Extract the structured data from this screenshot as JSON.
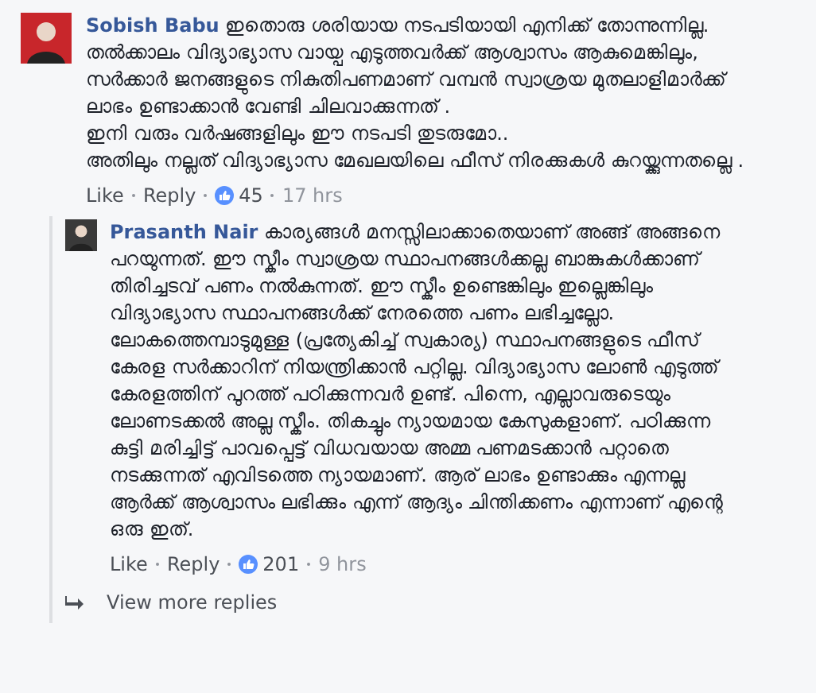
{
  "comments": [
    {
      "author": "Sobish Babu",
      "paragraphs": [
        "ഇതൊരു ശരിയായ നടപടിയായി എനിക്ക് തോന്നുന്നില്ല. തൽക്കാലം വിദ്യാഭ്യാസ വായ്പ എടുത്തവർക്ക് ആശ്വാസം ആകുമെങ്കിലും, സർക്കാർ ജനങ്ങളുടെ നികുതിപണമാണ് വമ്പൻ സ്വാശ്രയ മുതലാളിമാർക്ക് ലാഭം ഉണ്ടാക്കാൻ വേണ്ടി ചിലവാക്കുന്നത് .",
        "ഇനി വരും വർഷങ്ങളിലും ഈ നടപടി തുടരുമോ..",
        "അതിലും നല്ലത് വിദ്യാഭ്യാസ മേഖലയിലെ ഫീസ് നിരക്കുകൾ കുറയ്ക്കുന്നതല്ലെ ."
      ],
      "actions": [
        "Like",
        "Reply"
      ],
      "likes": "45",
      "time": "17 hrs",
      "replies": [
        {
          "author": "Prasanth Nair",
          "paragraphs": [
            "കാര്യങ്ങൾ മനസ്സിലാക്കാതെയാണ് അങ്ങ് അങ്ങനെ പറയുന്നത്. ഈ സ്കീം സ്വാശ്രയ സ്ഥാപനങ്ങൾക്കല്ല ബാങ്കുകൾക്കാണ് തിരിച്ചടവ് പണം നൽകുന്നത്. ഈ സ്കീം ഉണ്ടെങ്കിലും ഇല്ലെങ്കിലും വിദ്യാഭ്യാസ സ്ഥാപനങ്ങൾക്ക് നേരത്തെ പണം ലഭിച്ചല്ലോ. ലോകത്തെമ്പാടുമുള്ള (പ്രത്യേകിച്ച് സ്വകാര്യ) സ്ഥാപനങ്ങളുടെ ഫീസ് കേരള സർക്കാറിന് നിയന്ത്രിക്കാൻ പറ്റില്ല. വിദ്യാഭ്യാസ ലോൺ എടുത്ത് കേരളത്തിന് പുറത്ത് പഠിക്കുന്നവർ ഉണ്ട്. പിന്നെ, എല്ലാവരുടെയും ലോണടക്കൽ അല്ല സ്കീം. തികച്ചും ന്യായമായ കേസുകളാണ്. പഠിക്കുന്ന കുട്ടി മരിച്ചിട്ട് പാവപ്പെട്ട് വിധവയായ അമ്മ പണമടക്കാൻ പറ്റാതെ നടക്കുന്നത് എവിടത്തെ ന്യായമാണ്. ആര് ലാഭം ഉണ്ടാക്കും എന്നല്ല ആർക്ക് ആശ്വാസം ലഭിക്കും എന്ന് ആദ്യം ചിന്തിക്കണം എന്നാണ് എന്റെ ഒരു ഇത്."
          ],
          "actions": [
            "Like",
            "Reply"
          ],
          "likes": "201",
          "time": "9 hrs"
        }
      ],
      "more_replies": "View more replies"
    }
  ]
}
